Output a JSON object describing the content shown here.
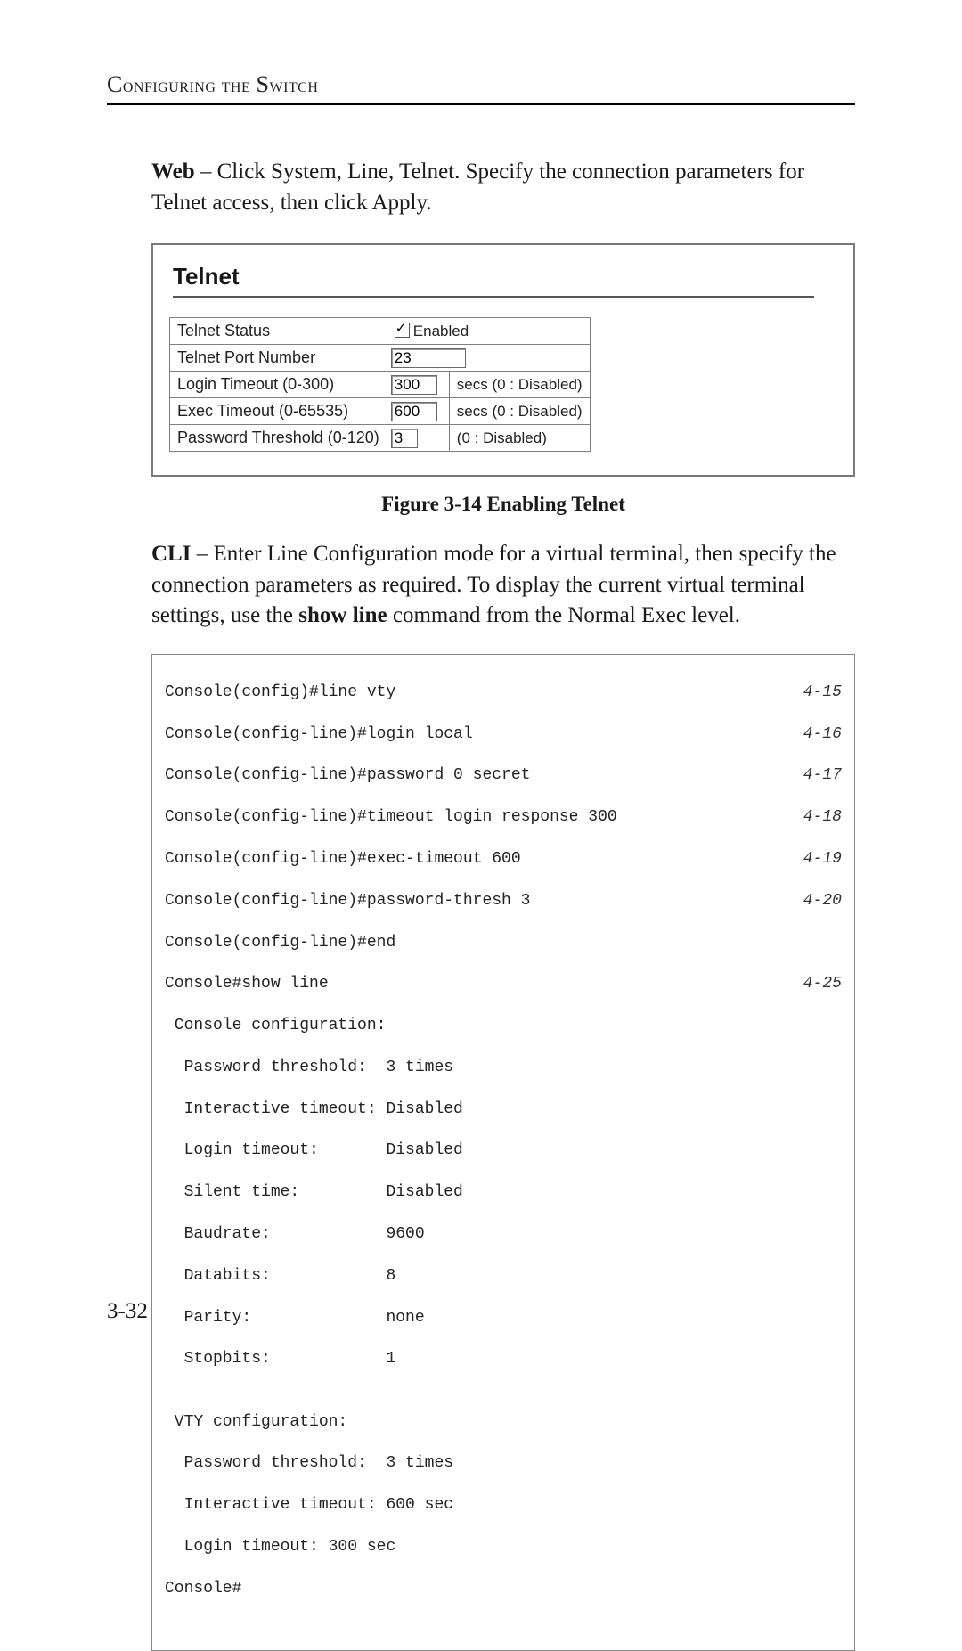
{
  "header": "Configuring the Switch",
  "para_web_lead": "Web",
  "para_web_rest": " – Click System, Line, Telnet. Specify the connection parameters for Telnet access, then click Apply.",
  "telnet": {
    "title": "Telnet",
    "rows": {
      "status_label": "Telnet Status",
      "status_box": "Enabled",
      "port_label": "Telnet Port Number",
      "port_value": "23",
      "login_label": "Login Timeout (0-300)",
      "login_value": "300",
      "login_note": "secs (0 : Disabled)",
      "exec_label": "Exec Timeout (0-65535)",
      "exec_value": "600",
      "exec_note": "secs (0 : Disabled)",
      "pw_label": "Password Threshold (0-120)",
      "pw_value": "3",
      "pw_note": "(0 : Disabled)"
    }
  },
  "figure_caption": "Figure 3-14  Enabling Telnet",
  "para_cli_lead": "CLI",
  "para_cli_mid1": " – Enter Line Configuration mode for a virtual terminal, then specify the connection parameters as required. To display the current virtual terminal settings, use the ",
  "para_cli_bold": "show line",
  "para_cli_mid2": " command from the Normal Exec level.",
  "cli": {
    "l1": "Console(config)#line vty",
    "r1": "4-15",
    "l2": "Console(config-line)#login local",
    "r2": "4-16",
    "l3": "Console(config-line)#password 0 secret",
    "r3": "4-17",
    "l4": "Console(config-line)#timeout login response 300",
    "r4": "4-18",
    "l5": "Console(config-line)#exec-timeout 600",
    "r5": "4-19",
    "l6": "Console(config-line)#password-thresh 3",
    "r6": "4-20",
    "l7": "Console(config-line)#end",
    "l8": "Console#show line",
    "r8": "4-25",
    "l9": " Console configuration:",
    "l10": "  Password threshold:  3 times",
    "l11": "  Interactive timeout: Disabled",
    "l12": "  Login timeout:       Disabled",
    "l13": "  Silent time:         Disabled",
    "l14": "  Baudrate:            9600",
    "l15": "  Databits:            8",
    "l16": "  Parity:              none",
    "l17": "  Stopbits:            1",
    "l18": "",
    "l19": " VTY configuration:",
    "l20": "  Password threshold:  3 times",
    "l21": "  Interactive timeout: 600 sec",
    "l22": "  Login timeout: 300 sec",
    "l23": "Console#"
  },
  "page_number": "3-32"
}
